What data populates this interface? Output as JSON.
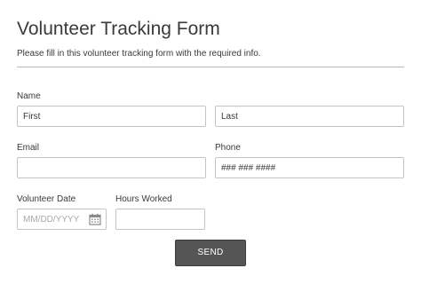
{
  "form": {
    "title": "Volunteer Tracking Form",
    "subtitle": "Please fill in this volunteer tracking form with the required info."
  },
  "name": {
    "label": "Name",
    "first_placeholder": "First",
    "last_placeholder": "Last"
  },
  "email": {
    "label": "Email",
    "placeholder": ""
  },
  "phone": {
    "label": "Phone",
    "placeholder": "### ### ####"
  },
  "volunteer_date": {
    "label": "Volunteer Date",
    "placeholder": "MM/DD/YYYY",
    "icon": "calendar-icon"
  },
  "hours_worked": {
    "label": "Hours Worked",
    "placeholder": ""
  },
  "submit": {
    "label": "SEND"
  },
  "colors": {
    "divider": "#b9b9b9",
    "field_border": "#c4c4c4",
    "button_bg": "#555555",
    "text": "#3a3a3a"
  }
}
